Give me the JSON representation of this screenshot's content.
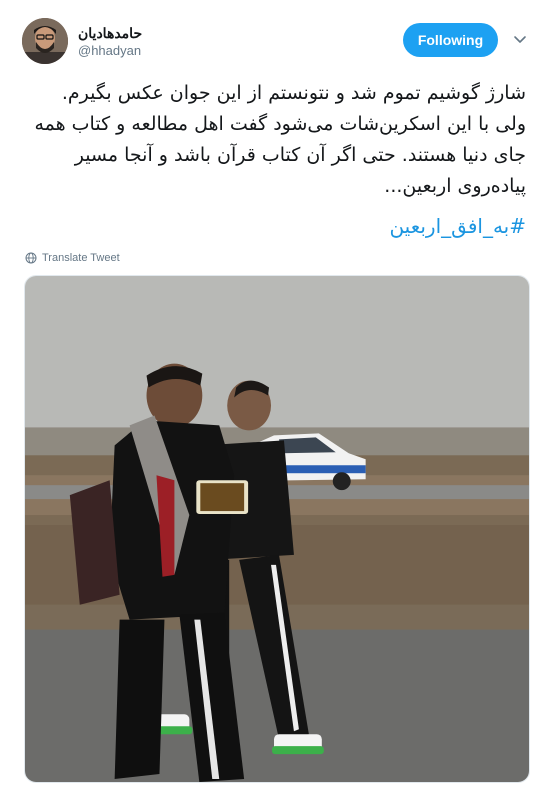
{
  "header": {
    "display_name": "حامدهادیان",
    "handle": "@hhadyan",
    "follow_label": "Following"
  },
  "tweet": {
    "lines": [
      "شارژ گوشیم تموم شد و نتونستم از این جوان عکس بگیرم.",
      "ولی با این اسکرین‌شات می‌شود گفت اهل مطالعه و کتاب همه",
      "جای دنیا هستند. حتی اگر آن کتاب قرآن باشد و آنجا مسیر",
      "پیاده‌روی اربعین..."
    ],
    "hashtag": "#به_افق_اربعین",
    "translate_label": "Translate Tweet"
  },
  "icons": {
    "caret": "chevron-down-icon",
    "translate": "globe-icon"
  },
  "colors": {
    "accent": "#1da1f2",
    "link": "#1b95e0",
    "secondary_text": "#657786"
  }
}
